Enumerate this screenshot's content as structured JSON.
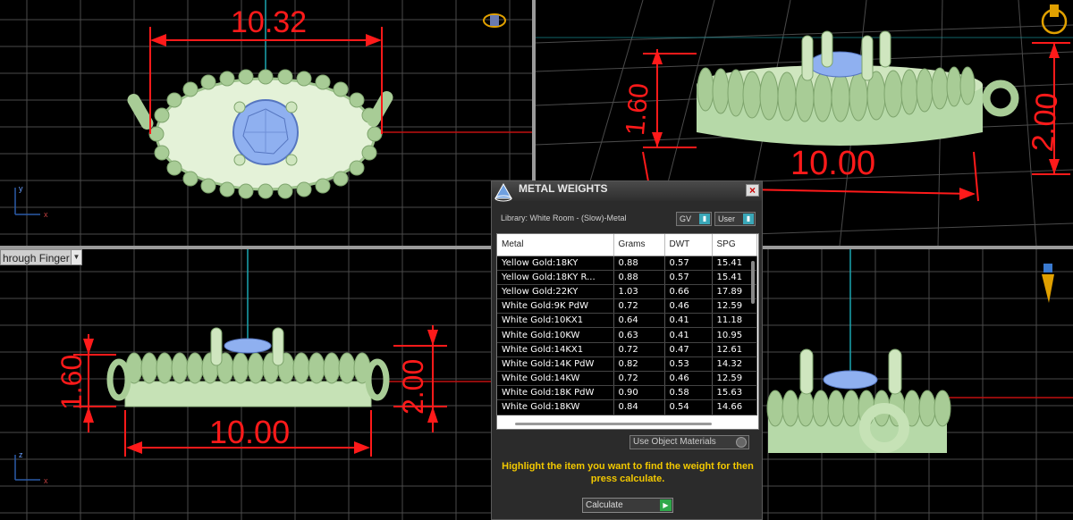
{
  "viewports": {
    "top": {
      "dimension": "10.32",
      "axis_x": "x",
      "axis_y": "y"
    },
    "perspective": {
      "dimensions": [
        "1.60",
        "2.00",
        "10.00"
      ]
    },
    "front": {
      "label": "hrough Finger",
      "dimensions": [
        "1.60",
        "2.00",
        "10.00"
      ],
      "axis_x": "x",
      "axis_y": "z"
    },
    "side": {}
  },
  "dialog": {
    "title": "METAL WEIGHTS",
    "library": "Library: White Room - (Slow)-Metal",
    "toggle_gv": "GV",
    "toggle_user": "User",
    "columns": [
      "Metal",
      "Grams",
      "DWT",
      "SPG"
    ],
    "rows": [
      [
        "Yellow Gold:18KY",
        "0.88",
        "0.57",
        "15.41"
      ],
      [
        "Yellow Gold:18KY R...",
        "0.88",
        "0.57",
        "15.41"
      ],
      [
        "Yellow Gold:22KY",
        "1.03",
        "0.66",
        "17.89"
      ],
      [
        "White Gold:9K PdW",
        "0.72",
        "0.46",
        "12.59"
      ],
      [
        "White Gold:10KX1",
        "0.64",
        "0.41",
        "11.18"
      ],
      [
        "White Gold:10KW",
        "0.63",
        "0.41",
        "10.95"
      ],
      [
        "White Gold:14KX1",
        "0.72",
        "0.47",
        "12.61"
      ],
      [
        "White Gold:14K PdW",
        "0.82",
        "0.53",
        "14.32"
      ],
      [
        "White Gold:14KW",
        "0.72",
        "0.46",
        "12.59"
      ],
      [
        "White Gold:18K PdW",
        "0.90",
        "0.58",
        "15.63"
      ],
      [
        "White Gold:18KW",
        "0.84",
        "0.54",
        "14.66"
      ]
    ],
    "use_object_materials": "Use Object Materials",
    "hint": "Highlight the item you want to find the weight for then press calculate.",
    "calculate": "Calculate"
  },
  "colors": {
    "model": "#b6d9a8",
    "model_light": "#d6edc8",
    "gem": "#8fb0f0",
    "dimension": "#ff1a1a",
    "grid": "#5a5a5a",
    "axis_cyan": "#1aa6b0"
  }
}
